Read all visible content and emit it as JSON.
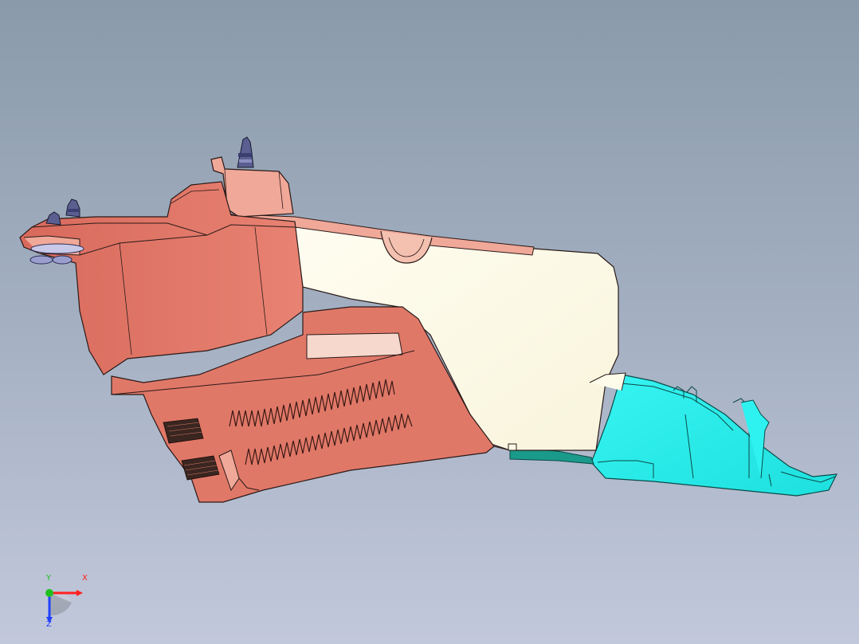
{
  "viewport": {
    "background_top": "#8a9aab",
    "background_bottom": "#c2c8db"
  },
  "model": {
    "colors": {
      "salmon": "#e07868",
      "salmon_light": "#f0a898",
      "salmon_dark": "#b85848",
      "cream": "#fdfbe9",
      "cyan": "#2ef2f0",
      "cyan_dark": "#14b8b6",
      "teal": "#1a9a8a",
      "fastener": "#4a4e7e",
      "edge": "#2a1a18"
    }
  },
  "triad": {
    "x_label": "X",
    "y_label": "Y",
    "z_label": "Z",
    "x_color": "#ff2020",
    "y_color": "#20c020",
    "z_color": "#2040ff"
  }
}
